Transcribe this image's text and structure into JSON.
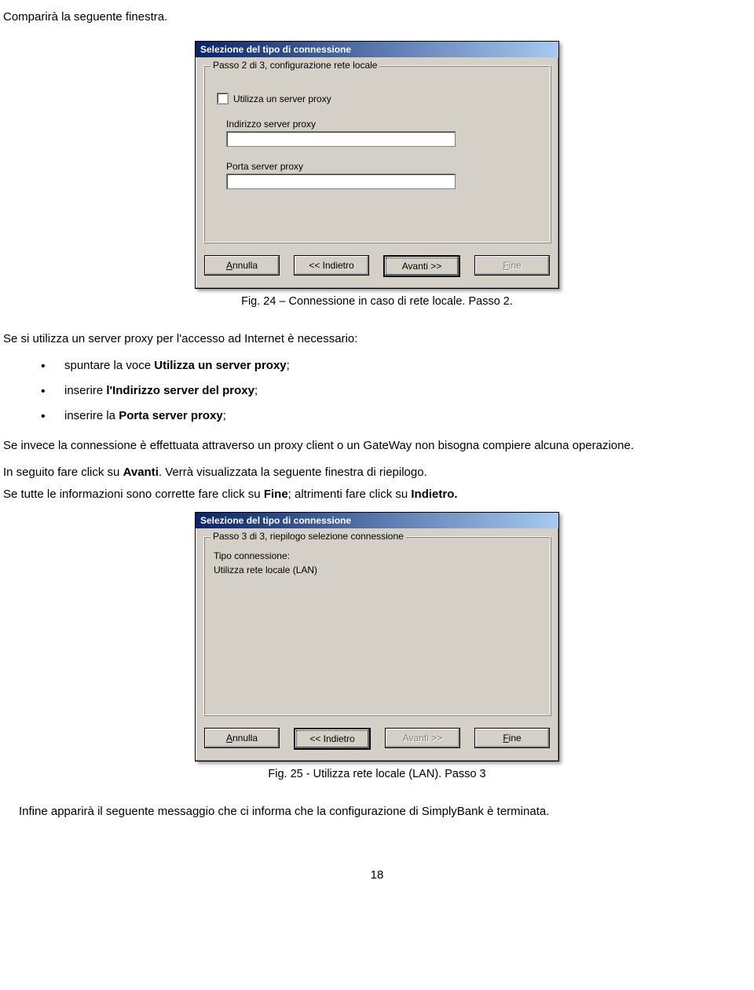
{
  "intro_line": "Comparirà la seguente finestra.",
  "dialog1": {
    "title": "Selezione del tipo di connessione",
    "group_label": "Passo 2 di  3, configurazione rete locale",
    "check_label": "Utilizza un server proxy",
    "field1_label": "Indirizzo server proxy",
    "field2_label": "Porta server proxy",
    "buttons": {
      "cancel_accel": "A",
      "cancel_rest": "nnulla",
      "back": "<<  Indietro",
      "next": "Avanti >>",
      "finish_accel": "F",
      "finish_rest": "ine"
    }
  },
  "caption1": "Fig. 24 – Connessione in caso di rete locale. Passo 2.",
  "para_intro": "Se si utilizza un server proxy per l'accesso ad Internet è necessario:",
  "bullets": {
    "b1_pre": "spuntare la voce ",
    "b1_bold": "Utilizza un server proxy",
    "b1_post": ";",
    "b2_pre": "inserire ",
    "b2_bold": "l'Indirizzo server del proxy",
    "b2_post": ";",
    "b3_pre": "inserire la ",
    "b3_bold": "Porta server proxy",
    "b3_post": ";"
  },
  "para_proxy": "Se invece la connessione è effettuata attraverso un proxy client o un GateWay non bisogna compiere alcuna operazione.",
  "para_avanti_pre": "In seguito fare click su ",
  "para_avanti_bold": "Avanti",
  "para_avanti_post": ". Verrà visualizzata la seguente finestra di riepilogo.",
  "para_fine_1": "Se tutte le informazioni sono corrette fare click su ",
  "para_fine_b1": "Fine",
  "para_fine_2": "; altrimenti fare click su ",
  "para_fine_b2": "Indietro.",
  "dialog2": {
    "title": "Selezione del tipo di connessione",
    "group_label": "Passo 3 di  3, riepilogo selezione connessione",
    "summary_line1": "Tipo connessione:",
    "summary_line2": "Utilizza rete locale (LAN)",
    "buttons": {
      "cancel_accel": "A",
      "cancel_rest": "nnulla",
      "back": "<<  Indietro",
      "next": "Avanti >>",
      "finish_accel": "F",
      "finish_rest": "ine"
    }
  },
  "caption2": "Fig. 25 - Utilizza rete locale (LAN). Passo 3",
  "para_final": "Infine apparirà il seguente messaggio che ci informa che la configurazione di SimplyBank è terminata.",
  "page_number": "18"
}
